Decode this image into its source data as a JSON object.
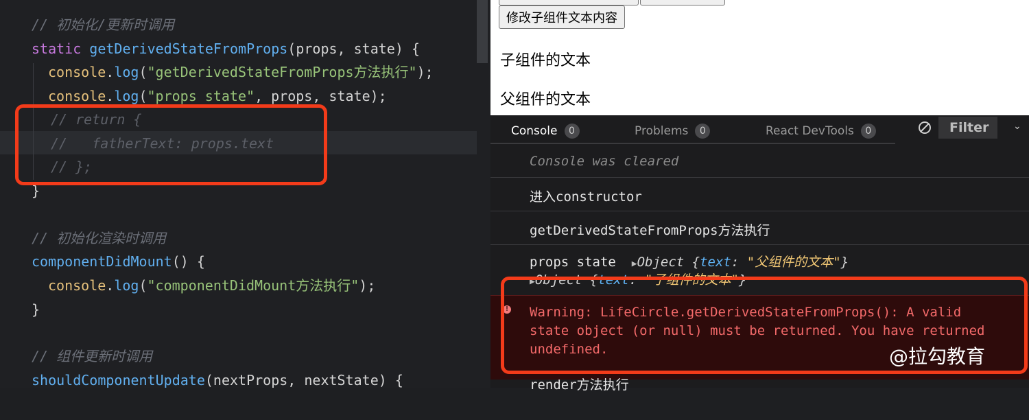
{
  "editor": {
    "lines": [
      {
        "id": "l1",
        "parts": [
          {
            "c": "cm",
            "t": "// 初始化/更新时调用"
          }
        ]
      },
      {
        "id": "l2",
        "parts": [
          {
            "c": "kw",
            "t": "static "
          },
          {
            "c": "fn",
            "t": "getDerivedStateFromProps"
          },
          {
            "c": "pl",
            "t": "(props, state) {"
          }
        ]
      },
      {
        "id": "l3",
        "parts": [
          {
            "c": "obj",
            "t": "console"
          },
          {
            "c": "pl",
            "t": "."
          },
          {
            "c": "fn",
            "t": "log"
          },
          {
            "c": "pl",
            "t": "("
          },
          {
            "c": "str",
            "t": "\"getDerivedStateFromProps方法执行\""
          },
          {
            "c": "pl",
            "t": ");"
          }
        ]
      },
      {
        "id": "l4",
        "parts": [
          {
            "c": "obj",
            "t": "console"
          },
          {
            "c": "pl",
            "t": "."
          },
          {
            "c": "fn",
            "t": "log"
          },
          {
            "c": "pl",
            "t": "("
          },
          {
            "c": "str",
            "t": "\"props state\""
          },
          {
            "c": "pl",
            "t": ", props, state);"
          }
        ]
      },
      {
        "id": "l5",
        "parts": [
          {
            "c": "cm-dim",
            "t": "// return {"
          }
        ]
      },
      {
        "id": "l6",
        "parts": [
          {
            "c": "cm-dim",
            "t": "//   fatherText: props.text"
          }
        ]
      },
      {
        "id": "l7",
        "parts": [
          {
            "c": "cm-dim",
            "t": "// };"
          }
        ]
      },
      {
        "id": "l8",
        "parts": [
          {
            "c": "pl",
            "t": "}"
          }
        ]
      },
      {
        "id": "l9",
        "parts": [
          {
            "c": "cm",
            "t": "// 初始化渲染时调用"
          }
        ]
      },
      {
        "id": "l10",
        "parts": [
          {
            "c": "fn",
            "t": "componentDidMount"
          },
          {
            "c": "pl",
            "t": "() {"
          }
        ]
      },
      {
        "id": "l11",
        "parts": [
          {
            "c": "obj",
            "t": "console"
          },
          {
            "c": "pl",
            "t": "."
          },
          {
            "c": "fn",
            "t": "log"
          },
          {
            "c": "pl",
            "t": "("
          },
          {
            "c": "str",
            "t": "\"componentDidMount方法执行\""
          },
          {
            "c": "pl",
            "t": ");"
          }
        ]
      },
      {
        "id": "l12",
        "parts": [
          {
            "c": "pl",
            "t": "}"
          }
        ]
      },
      {
        "id": "l13",
        "parts": [
          {
            "c": "cm",
            "t": "// 组件更新时调用"
          }
        ]
      },
      {
        "id": "l14",
        "parts": [
          {
            "c": "fn",
            "t": "shouldComponentUpdate"
          },
          {
            "c": "pl",
            "t": "(nextProps, nextState) {"
          }
        ]
      }
    ]
  },
  "browser": {
    "button_label": "修改子组件文本内容",
    "child_text": "子组件的文本",
    "parent_text": "父组件的文本"
  },
  "devtools": {
    "tabs": [
      {
        "label": "Console",
        "count": "0"
      },
      {
        "label": "Problems",
        "count": "0"
      },
      {
        "label": "React DevTools",
        "count": "0"
      }
    ],
    "filter_label": "Filter",
    "messages": {
      "cleared": "Console was cleared",
      "constructor": "进入constructor",
      "gdsfp": "getDerivedStateFromProps方法执行",
      "props_label": "props state",
      "obj_word": "Object",
      "key_text": "text",
      "val_parent": "\"父组件的文本\"",
      "val_child": "\"子组件的文本\"",
      "warning_lines": [
        "Warning: LifeCircle.getDerivedStateFromProps(): A valid",
        "state object (or null) must be returned. You have returned",
        "undefined."
      ],
      "render": "render方法执行"
    }
  },
  "watermark": "@拉勾教育",
  "colors": {
    "highlight": "#f33b1a",
    "warning_text": "#f46a6a",
    "warning_bg": "#2e0b0b"
  },
  "icons": {
    "clear": "clear-console-icon",
    "error": "error-icon",
    "dropdown": "chevron-down-icon",
    "expand": "expand-triangle-icon"
  }
}
